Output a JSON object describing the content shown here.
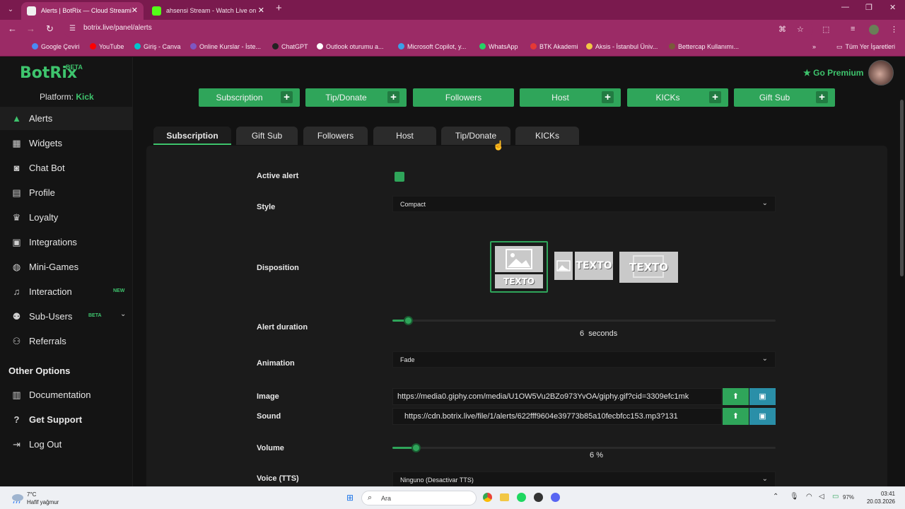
{
  "browser": {
    "tabs": [
      {
        "title": "Alerts | BotRix — Cloud Streami",
        "active": true
      },
      {
        "title": "ahsensi Stream - Watch Live on",
        "active": false
      }
    ],
    "url": "botrix.live/panel/alerts",
    "bookmarks": [
      "Google Çeviri",
      "YouTube",
      "Giriş - Canva",
      "Online Kurslar - İste...",
      "ChatGPT",
      "Outlook oturumu a...",
      "Microsoft Copilot, y...",
      "WhatsApp",
      "BTK Akademi",
      "Aksis - İstanbul Üniv...",
      "Bettercap Kullanımı...",
      "Tüm Yer İşaretleri"
    ]
  },
  "app": {
    "logo": "BotRix",
    "beta": "BETA",
    "platform_label": "Platform:",
    "platform_value": "Kick",
    "go_premium": "Go Premium",
    "sidebar": [
      {
        "label": "Alerts",
        "icon": "alert-triangle-icon",
        "active": true
      },
      {
        "label": "Widgets",
        "icon": "grid-icon"
      },
      {
        "label": "Chat Bot",
        "icon": "robot-icon"
      },
      {
        "label": "Profile",
        "icon": "id-card-icon"
      },
      {
        "label": "Loyalty",
        "icon": "trophy-icon"
      },
      {
        "label": "Integrations",
        "icon": "plug-icon"
      },
      {
        "label": "Mini-Games",
        "icon": "gamepad-icon"
      },
      {
        "label": "Interaction",
        "icon": "music-icon",
        "badge": "NEW"
      },
      {
        "label": "Sub-Users",
        "icon": "users-icon",
        "badge": "BETA"
      },
      {
        "label": "Referrals",
        "icon": "people-icon"
      }
    ],
    "other_options": "Other Options",
    "other_items": [
      {
        "label": "Documentation",
        "icon": "book-icon"
      },
      {
        "label": "Get Support",
        "icon": "question-icon"
      },
      {
        "label": "Log Out",
        "icon": "logout-icon"
      }
    ],
    "top_buttons": [
      {
        "label": "Subscription",
        "plus": true
      },
      {
        "label": "Tip/Donate",
        "plus": true
      },
      {
        "label": "Followers",
        "plus": false
      },
      {
        "label": "Host",
        "plus": true
      },
      {
        "label": "KICKs",
        "plus": true
      },
      {
        "label": "Gift Sub",
        "plus": true
      }
    ],
    "tabs": [
      "Subscription",
      "Gift Sub",
      "Followers",
      "Host",
      "Tip/Donate",
      "KICKs"
    ],
    "active_tab": "Subscription",
    "form": {
      "active_alert_label": "Active alert",
      "style_label": "Style",
      "style_value": "Compact",
      "disposition_label": "Disposition",
      "disposition_text": "TEXTO",
      "alert_duration_label": "Alert duration",
      "alert_duration_value": "6",
      "alert_duration_unit": "seconds",
      "alert_duration_fraction": 0.04,
      "animation_label": "Animation",
      "animation_value": "Fade",
      "image_label": "Image",
      "image_value": "https://media0.giphy.com/media/U1OW5Vu2BZo973YvOA/giphy.gif?cid=3309efc1mk",
      "sound_label": "Sound",
      "sound_value": "https://cdn.botrix.live/file/1/alerts/622fff9604e39773b85a10fecbfcc153.mp3?131",
      "volume_label": "Volume",
      "volume_value": "6",
      "volume_unit": "%",
      "volume_fraction": 0.06,
      "voice_label": "Voice (TTS)",
      "voice_value": "Ninguno (Desactivar TTS)"
    }
  },
  "taskbar": {
    "temp": "7°C",
    "weather": "Hafif yağmur",
    "search": "Ara",
    "battery": "97%",
    "time": "03:41",
    "date": "20.03.2026"
  },
  "colors": {
    "accent": "#2fa55a",
    "brand": "#3ec46d",
    "chrome": "#9b2b66"
  }
}
